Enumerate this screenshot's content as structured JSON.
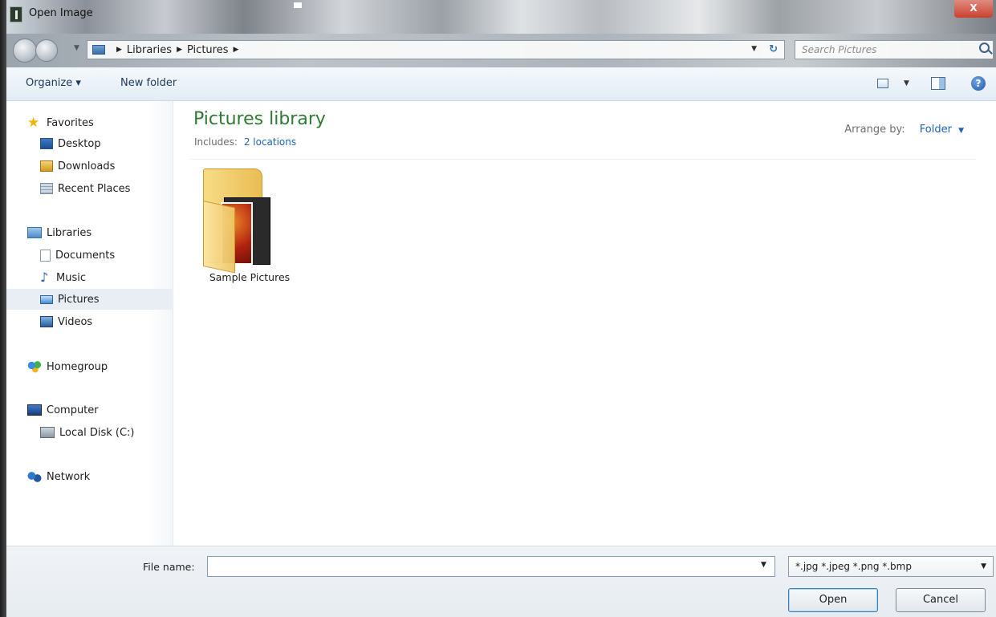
{
  "window": {
    "title": "Open Image",
    "close_label": "X"
  },
  "address": {
    "crumbs": [
      "Libraries",
      "Pictures"
    ],
    "search_placeholder": "Search Pictures"
  },
  "toolbar": {
    "organize_label": "Organize ▾",
    "new_folder_label": "New folder",
    "help_label": "?"
  },
  "nav": {
    "favorites": "Favorites",
    "desktop": "Desktop",
    "downloads": "Downloads",
    "recent_places": "Recent Places",
    "libraries": "Libraries",
    "documents": "Documents",
    "music": "Music",
    "pictures": "Pictures",
    "videos": "Videos",
    "homegroup": "Homegroup",
    "computer": "Computer",
    "local_disk": "Local Disk (C:)",
    "network": "Network",
    "selected": "Pictures"
  },
  "content": {
    "title": "Pictures library",
    "includes_label": "Includes:",
    "includes_link": "2 locations",
    "arrange_label": "Arrange by:",
    "arrange_value": "Folder",
    "items": [
      {
        "name": "Sample Pictures",
        "type": "folder"
      }
    ]
  },
  "bottom": {
    "file_name_label": "File name:",
    "file_name_value": "",
    "filter": "*.jpg *.jpeg *.png *.bmp",
    "open_label": "Open",
    "cancel_label": "Cancel"
  },
  "colors": {
    "library_title": "#2f7a34",
    "link": "#1e64b5"
  }
}
